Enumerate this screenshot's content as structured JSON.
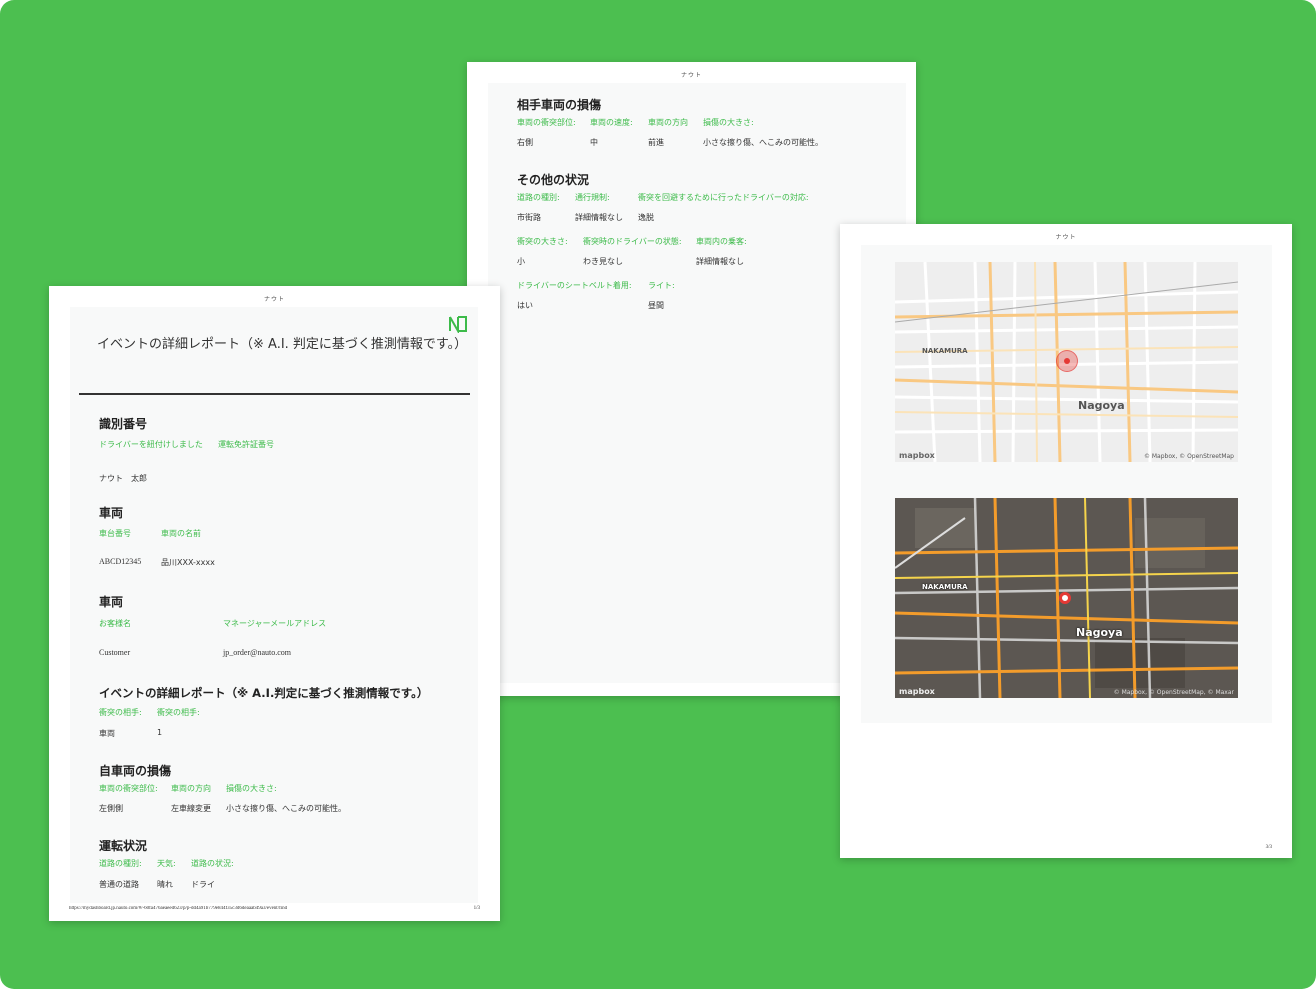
{
  "brand_name": "ナウト",
  "page1": {
    "report_title": "イベントの詳細レポート（※ A.I. 判定に基づく推測情報です。）",
    "sections": {
      "identification": {
        "title": "識別番号",
        "labels": [
          "ドライバーを紐付けしました",
          "運転免許証番号"
        ],
        "values": [
          "ナウト　太郎"
        ]
      },
      "vehicle1": {
        "title": "車両",
        "labels": [
          "車台番号",
          "車両の名前"
        ],
        "values": [
          "ABCD12345",
          "品川XXX-xxxx"
        ]
      },
      "vehicle2": {
        "title": "車両",
        "labels": [
          "お客様名",
          "マネージャーメールアドレス"
        ],
        "values": [
          "Customer",
          "jp_order@nauto.com"
        ]
      },
      "event": {
        "title": "イベントの詳細レポート（※ A.I.判定に基づく推測情報です。）",
        "labels": [
          "衝突の相手:",
          "衝突の相手:"
        ],
        "values": [
          "車両",
          "1"
        ]
      },
      "own_damage": {
        "title": "自車両の損傷",
        "labels": [
          "車両の衝突部位:",
          "車両の方向",
          "損傷の大きさ:"
        ],
        "values": [
          "左側側",
          "左車線変更",
          "小さな擦り傷、へこみの可能性。"
        ]
      },
      "driving": {
        "title": "運転状況",
        "labels": [
          "道路の種別:",
          "天気:",
          "道路の状況:"
        ],
        "values": [
          "普通の道路",
          "晴れ",
          "ドライ"
        ]
      }
    },
    "footer_url": "https://mydashboard.jp.nauto.com/#/-60fa476aeaeed623/p/p-dd4a91b779e844f35c3d6deaaab49a3/event/find",
    "footer_page": "1/3"
  },
  "page2": {
    "sections": {
      "other_damage": {
        "title": "相手車両の損傷",
        "labels": [
          "車両の衝突部位:",
          "車両の速度:",
          "車両の方向",
          "損傷の大きさ:"
        ],
        "values": [
          "右側",
          "中",
          "前進",
          "小さな擦り傷、へこみの可能性。"
        ]
      },
      "other_status": {
        "title": "その他の状況",
        "labels_row1": [
          "道路の種別:",
          "通行規制:",
          "衝突を回避するために行ったドライバーの対応:"
        ],
        "values_row1": [
          "市街路",
          "詳細情報なし",
          "逸脱"
        ],
        "labels_row2": [
          "衝突の大きさ:",
          "衝突時のドライバーの状態:",
          "車両内の乗客:"
        ],
        "values_row2": [
          "小",
          "わき見なし",
          "詳細情報なし"
        ],
        "labels_row3": [
          "ドライバーのシートベルト着用:",
          "ライト:"
        ],
        "values_row3": [
          "はい",
          "昼間"
        ]
      }
    }
  },
  "page3": {
    "map_city_label": "Nagoya",
    "map_district_label": "NAKAMURA",
    "map_credit_street": "© Mapbox, © OpenStreetMap",
    "map_credit_sat": "© Mapbox, © OpenStreetMap, © Maxar",
    "map_logo": "mapbox",
    "footer_page": "3/3"
  },
  "colors": {
    "background": "#4cbf50",
    "label_green": "#3dbb4a",
    "pin_red": "#e53935"
  }
}
